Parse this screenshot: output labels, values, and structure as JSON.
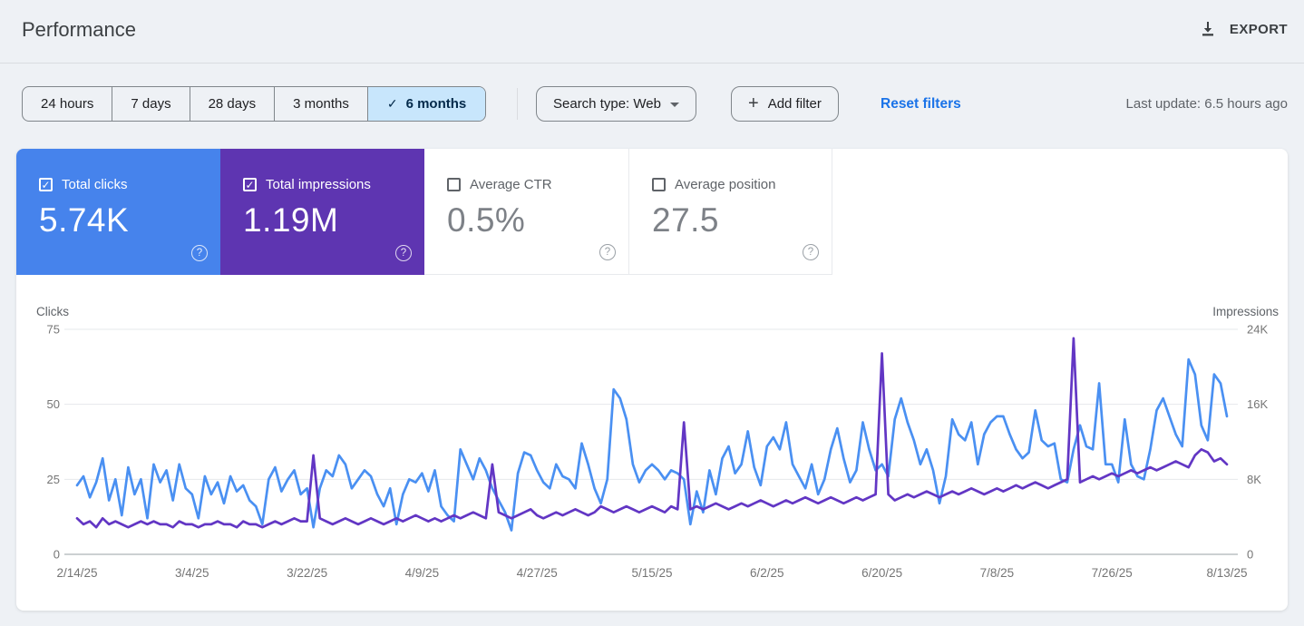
{
  "header": {
    "title": "Performance",
    "export_label": "EXPORT"
  },
  "filters": {
    "date_ranges": [
      "24 hours",
      "7 days",
      "28 days",
      "3 months",
      "6 months"
    ],
    "selected_range": "6 months",
    "search_type": "Search type: Web",
    "add_filter": "Add filter",
    "reset_filters": "Reset filters",
    "last_update": "Last update: 6.5 hours ago"
  },
  "metrics": [
    {
      "label": "Total clicks",
      "value": "5.74K",
      "checked": true,
      "color": "#4683ec"
    },
    {
      "label": "Total impressions",
      "value": "1.19M",
      "checked": true,
      "color": "#5e35b1"
    },
    {
      "label": "Average CTR",
      "value": "0.5%",
      "checked": false,
      "color": "#ffffff"
    },
    {
      "label": "Average position",
      "value": "27.5",
      "checked": false,
      "color": "#ffffff"
    }
  ],
  "chart_data": {
    "type": "line",
    "x_start": "2/14/25",
    "x_end": "8/13/25",
    "x_unit": "day",
    "x_ticks": [
      "2/14/25",
      "3/4/25",
      "3/22/25",
      "4/9/25",
      "4/27/25",
      "5/15/25",
      "6/2/25",
      "6/20/25",
      "7/8/25",
      "7/26/25",
      "8/13/25"
    ],
    "left_axis": {
      "title": "Clicks",
      "ticks": [
        "75",
        "50",
        "25",
        "0"
      ],
      "range": [
        0,
        75
      ]
    },
    "right_axis": {
      "title": "Impressions",
      "ticks": [
        "24K",
        "16K",
        "8K",
        "0"
      ],
      "range": [
        0,
        24000
      ]
    },
    "grid": true,
    "legend": "none",
    "series": [
      {
        "name": "Clicks",
        "axis": "left",
        "color": "#4a90f2",
        "values": [
          23,
          26,
          19,
          24,
          32,
          18,
          25,
          13,
          29,
          20,
          25,
          12,
          30,
          24,
          28,
          18,
          30,
          22,
          20,
          12,
          26,
          20,
          24,
          17,
          26,
          21,
          23,
          18,
          16,
          10,
          25,
          29,
          21,
          25,
          28,
          20,
          22,
          9,
          22,
          28,
          26,
          33,
          30,
          22,
          25,
          28,
          26,
          20,
          16,
          22,
          10,
          20,
          25,
          24,
          27,
          21,
          28,
          16,
          13,
          11,
          35,
          30,
          25,
          32,
          28,
          22,
          18,
          14,
          8,
          27,
          34,
          33,
          28,
          24,
          22,
          30,
          26,
          25,
          22,
          37,
          30,
          22,
          17,
          25,
          55,
          52,
          45,
          30,
          24,
          28,
          30,
          28,
          25,
          28,
          27,
          25,
          10,
          21,
          14,
          28,
          20,
          32,
          36,
          27,
          30,
          41,
          29,
          23,
          36,
          39,
          35,
          44,
          30,
          26,
          22,
          30,
          20,
          25,
          35,
          42,
          32,
          24,
          28,
          44,
          35,
          28,
          30,
          26,
          45,
          52,
          44,
          38,
          30,
          35,
          28,
          17,
          26,
          45,
          40,
          38,
          44,
          30,
          40,
          44,
          46,
          46,
          40,
          35,
          32,
          34,
          48,
          38,
          36,
          37,
          25,
          24,
          35,
          43,
          36,
          35,
          57,
          30,
          30,
          24,
          45,
          30,
          26,
          25,
          35,
          48,
          52,
          46,
          40,
          36,
          65,
          60,
          43,
          38,
          60,
          57,
          46
        ]
      },
      {
        "name": "Impressions",
        "axis": "right",
        "color": "#6236c4",
        "values": [
          3840,
          3200,
          3520,
          2880,
          3840,
          3200,
          3520,
          3200,
          2880,
          3200,
          3520,
          3200,
          3520,
          3200,
          3200,
          2880,
          3520,
          3200,
          3200,
          2880,
          3200,
          3200,
          3520,
          3200,
          3200,
          2880,
          3520,
          3200,
          3200,
          2880,
          3200,
          3520,
          3200,
          3520,
          3840,
          3520,
          3520,
          10560,
          3840,
          3520,
          3200,
          3520,
          3840,
          3520,
          3200,
          3520,
          3840,
          3520,
          3200,
          3520,
          3840,
          3520,
          3840,
          4160,
          3840,
          3520,
          3840,
          3520,
          3840,
          4160,
          3840,
          4160,
          4480,
          4160,
          3840,
          9600,
          4480,
          4160,
          3840,
          4160,
          4480,
          4800,
          4160,
          3840,
          4160,
          4480,
          4160,
          4480,
          4800,
          4480,
          4160,
          4480,
          5120,
          4800,
          4480,
          4800,
          5120,
          4800,
          4480,
          4800,
          5120,
          4800,
          4480,
          5120,
          4800,
          14080,
          4800,
          5120,
          4800,
          5120,
          5440,
          5120,
          4800,
          5120,
          5440,
          5120,
          5440,
          5760,
          5440,
          5120,
          5440,
          5760,
          5440,
          5760,
          6080,
          5760,
          5440,
          5760,
          6080,
          5760,
          5440,
          5760,
          6080,
          5760,
          6080,
          6400,
          21440,
          6400,
          5760,
          6080,
          6400,
          6080,
          6400,
          6720,
          6400,
          6080,
          6400,
          6720,
          6400,
          6720,
          7040,
          6720,
          6400,
          6720,
          7040,
          6720,
          7040,
          7360,
          7040,
          7360,
          7680,
          7360,
          7040,
          7360,
          7680,
          8000,
          23040,
          7680,
          8000,
          8320,
          8000,
          8320,
          8640,
          8320,
          8640,
          8960,
          8640,
          8960,
          9280,
          8960,
          9280,
          9600,
          9920,
          9600,
          9280,
          10560,
          11200,
          10880,
          9920,
          10240,
          9600
        ]
      }
    ]
  }
}
